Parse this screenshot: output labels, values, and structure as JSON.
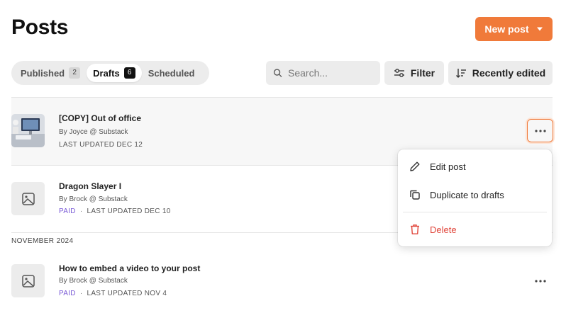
{
  "header": {
    "title": "Posts",
    "new_post_label": "New post"
  },
  "tabs": [
    {
      "label": "Published",
      "count": "2"
    },
    {
      "label": "Drafts",
      "count": "6"
    },
    {
      "label": "Scheduled"
    }
  ],
  "active_tab": "Drafts",
  "search": {
    "placeholder": "Search...",
    "value": ""
  },
  "filter_label": "Filter",
  "sort_label": "Recently edited",
  "posts": [
    {
      "title": "[COPY] Out of office",
      "author": "By Joyce @ Substack",
      "updated": "LAST UPDATED DEC 12",
      "thumbnail": "photo"
    },
    {
      "title": "Dragon Slayer I",
      "author": "By Brock @ Substack",
      "badge": "PAID",
      "separator": "·",
      "updated": "LAST UPDATED DEC 10",
      "thumbnail": "image-placeholder-icon"
    },
    {
      "title": "How to embed a video to your post",
      "author": "By Brock @ Substack",
      "badge": "PAID",
      "separator": "·",
      "updated": "LAST UPDATED NOV 4",
      "thumbnail": "image-placeholder-icon"
    }
  ],
  "section_label": "NOVEMBER 2024",
  "context_menu": {
    "items": [
      {
        "label": "Edit post",
        "icon": "pencil-icon"
      },
      {
        "label": "Duplicate to drafts",
        "icon": "copy-icon"
      },
      {
        "label": "Delete",
        "icon": "trash-icon",
        "danger": true
      }
    ]
  },
  "colors": {
    "accent": "#f07a3a",
    "paid": "#7a5bd6",
    "danger": "#e0453a"
  }
}
